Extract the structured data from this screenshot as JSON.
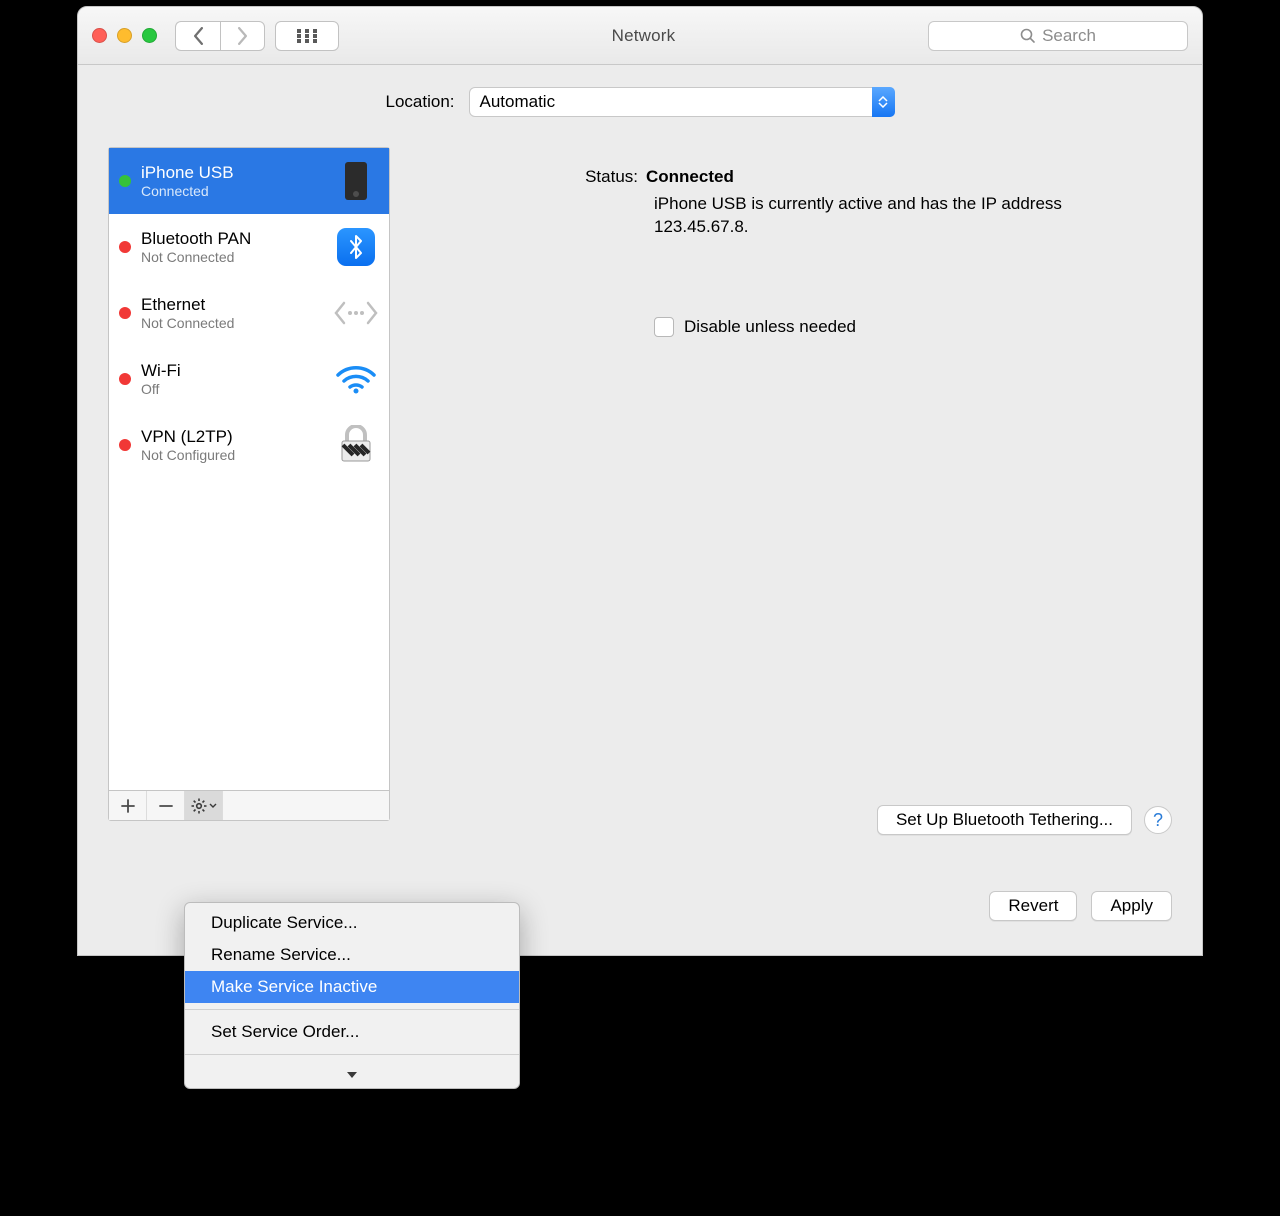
{
  "window": {
    "title": "Network"
  },
  "search": {
    "placeholder": "Search"
  },
  "location": {
    "label": "Location:",
    "value": "Automatic"
  },
  "services": [
    {
      "name": "iPhone USB",
      "status": "Connected",
      "dot": "green",
      "selected": true
    },
    {
      "name": "Bluetooth PAN",
      "status": "Not Connected",
      "dot": "red",
      "selected": false
    },
    {
      "name": "Ethernet",
      "status": "Not Connected",
      "dot": "red",
      "selected": false
    },
    {
      "name": "Wi-Fi",
      "status": "Off",
      "dot": "red",
      "selected": false
    },
    {
      "name": "VPN (L2TP)",
      "status": "Not Configured",
      "dot": "red",
      "selected": false
    }
  ],
  "detail": {
    "status_label": "Status:",
    "status_value": "Connected",
    "status_desc": "iPhone USB is currently active and has the IP address 123.45.67.8.",
    "disable_label": "Disable unless needed",
    "setup_button": "Set Up Bluetooth Tethering..."
  },
  "footer": {
    "revert": "Revert",
    "apply": "Apply"
  },
  "menu": {
    "items": [
      "Duplicate Service...",
      "Rename Service...",
      "Make Service Inactive",
      "Set Service Order..."
    ],
    "highlight_index": 2
  }
}
